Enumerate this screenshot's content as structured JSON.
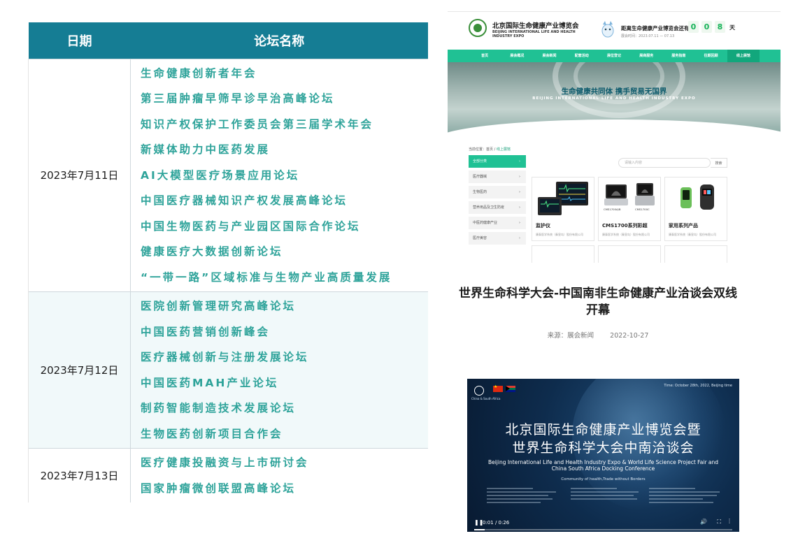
{
  "schedule": {
    "headers": {
      "date": "日期",
      "forum": "论坛名称"
    },
    "groups": [
      {
        "date": "2023年7月11日",
        "forums": [
          "生命健康创新者年会",
          "第三届肿瘤早筛早诊早治高峰论坛",
          "知识产权保护工作委员会第三届学术年会",
          "新媒体助力中医药发展",
          "AI大模型医疗场景应用论坛",
          "中国医疗器械知识产权发展高峰论坛",
          "中国生物医药与产业园区国际合作论坛",
          "健康医疗大数据创新论坛",
          "“一带一路”区域标准与生物产业高质量发展"
        ]
      },
      {
        "date": "2023年7月12日",
        "forums": [
          "医院创新管理研究高峰论坛",
          "中国医药营销创新峰会",
          "医疗器械创新与注册发展论坛",
          "中国医药MAH产业论坛",
          "制药智能制造技术发展论坛",
          "生物医药创新项目合作会"
        ]
      },
      {
        "date": "2023年7月13日",
        "forums": [
          "医疗健康投融资与上市研讨会",
          "国家肿瘤微创联盟高峰论坛"
        ]
      }
    ]
  },
  "expo": {
    "site_name": "北京国际生命健康产业博览会",
    "site_name_en": "BEIJING INTERNATIONAL LIFE AND HEALTH INDUSTRY EXPO",
    "countdown_label": "距离生命健康产业博览会还有",
    "countdown_dates": "展会时间：2023.07.11 — 07.13",
    "countdown_digits": [
      "0",
      "0",
      "8"
    ],
    "countdown_unit": "天",
    "nav": [
      "首页",
      "展会概况",
      "展会新闻",
      "配套活动",
      "展位登记",
      "展商服务",
      "服务指南",
      "往期回顾",
      "线上展馆"
    ],
    "nav_active": 8,
    "banner_slogan": "生命健康共同体 携手贸易无国界",
    "banner_slogan_en": "BEIJING INTERNATIONAL LIFE AND HEALTH INDUSTRY EXPO",
    "crumb_prefix": "当前位置：",
    "crumb_home": "首页",
    "crumb_sep": " / ",
    "crumb_current": "线上展馆",
    "categories": [
      "全部分类",
      "医疗器械",
      "生物医药",
      "营养用品及卫生防疫",
      "中医药健康产业",
      "医疗美容"
    ],
    "search_placeholder": "请输入内容",
    "search_button": "搜索",
    "products": [
      {
        "title": "监护仪",
        "company": "康泰医学系统（秦皇岛）股份有限公司",
        "captions": []
      },
      {
        "title": "CMS1700系列彩超",
        "company": "康泰医学系统（秦皇岛）股份有限公司",
        "captions": [
          "CMS1700A/B",
          "CMS1700C"
        ]
      },
      {
        "title": "家用系列产品",
        "company": "康泰医学系统（秦皇岛）股份有限公司",
        "captions": []
      }
    ],
    "accent_color": "#20c194"
  },
  "article": {
    "title": "世界生命科学大会-中国南非生命健康产业洽谈会双线开幕",
    "source": "来源：展会新闻",
    "date": "2022-10-27"
  },
  "video": {
    "org": "China & South Africa",
    "time_note": "Time: October 28th, 2022, Beijing time",
    "title_line1": "北京国际生命健康产业博览会暨",
    "title_line2": "世界生命科学大会中南洽谈会",
    "subtitle_en": "Beijing International Life and Health Industry Expo & World Life Science Project Fair and China South Africa Docking Conference",
    "tagline": "Community of health,Trade without Borders",
    "timecode": "0:01 / 0:26",
    "progress": 0.04
  }
}
